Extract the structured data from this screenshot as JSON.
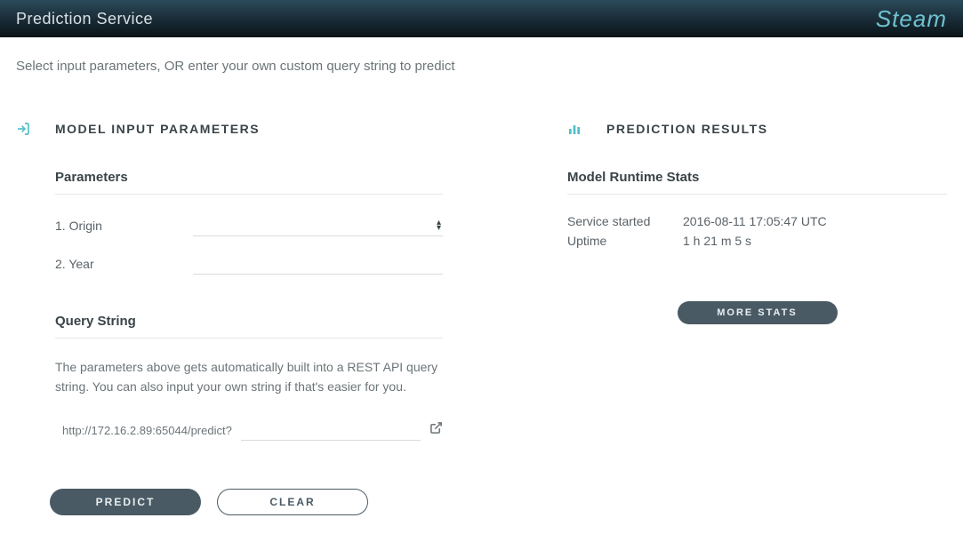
{
  "header": {
    "title": "Prediction Service",
    "brand": "Steam"
  },
  "subtitle": "Select input parameters, OR enter your own custom query string to predict",
  "input_section": {
    "title": "MODEL INPUT PARAMETERS",
    "parameters_heading": "Parameters",
    "params": [
      {
        "label": "1. Origin",
        "type": "select",
        "value": ""
      },
      {
        "label": "2. Year",
        "type": "text",
        "value": ""
      }
    ],
    "query_heading": "Query String",
    "query_desc": "The parameters above gets automatically built into a REST API query string. You can also input your own string if that's easier for you.",
    "query_prefix": "http://172.16.2.89:65044/predict?",
    "query_value": ""
  },
  "buttons": {
    "predict": "PREDICT",
    "clear": "CLEAR"
  },
  "results_section": {
    "title": "PREDICTION RESULTS",
    "stats_heading": "Model Runtime Stats",
    "stats": [
      {
        "label": "Service started",
        "value": "2016-08-11 17:05:47 UTC"
      },
      {
        "label": "Uptime",
        "value": "1 h 21 m 5 s"
      }
    ],
    "more_stats": "MORE STATS"
  }
}
